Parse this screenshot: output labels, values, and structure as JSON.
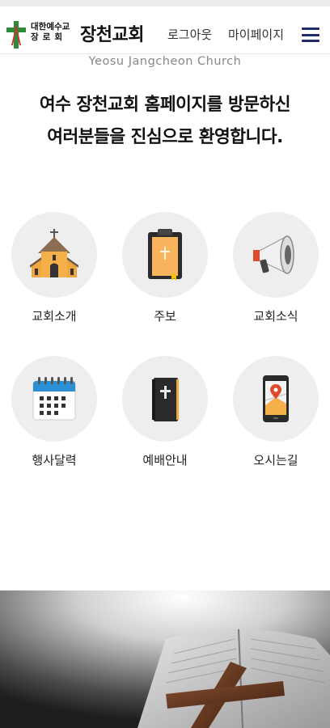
{
  "header": {
    "denomination_line1": "대한예수교",
    "denomination_line2": "장로회",
    "church_name": "장천교회",
    "logout_label": "로그아웃",
    "mypage_label": "마이페이지"
  },
  "hero": {
    "subtitle": "Yeosu Jangcheon Church",
    "welcome_line1": "여수 장천교회 홈페이지를 방문하신",
    "welcome_line2": "여러분들을 진심으로 환영합니다."
  },
  "menu": [
    {
      "label": "교회소개",
      "icon": "church-building-icon"
    },
    {
      "label": "주보",
      "icon": "bulletin-clipboard-icon"
    },
    {
      "label": "교회소식",
      "icon": "megaphone-icon"
    },
    {
      "label": "행사달력",
      "icon": "calendar-icon"
    },
    {
      "label": "예배안내",
      "icon": "bible-icon"
    },
    {
      "label": "오시는길",
      "icon": "map-phone-icon"
    }
  ],
  "colors": {
    "hamburger": "#1f2d6b",
    "logo_green": "#2e8b3a",
    "logo_red": "#d32f2f",
    "tile_circle": "#eeeeee"
  }
}
